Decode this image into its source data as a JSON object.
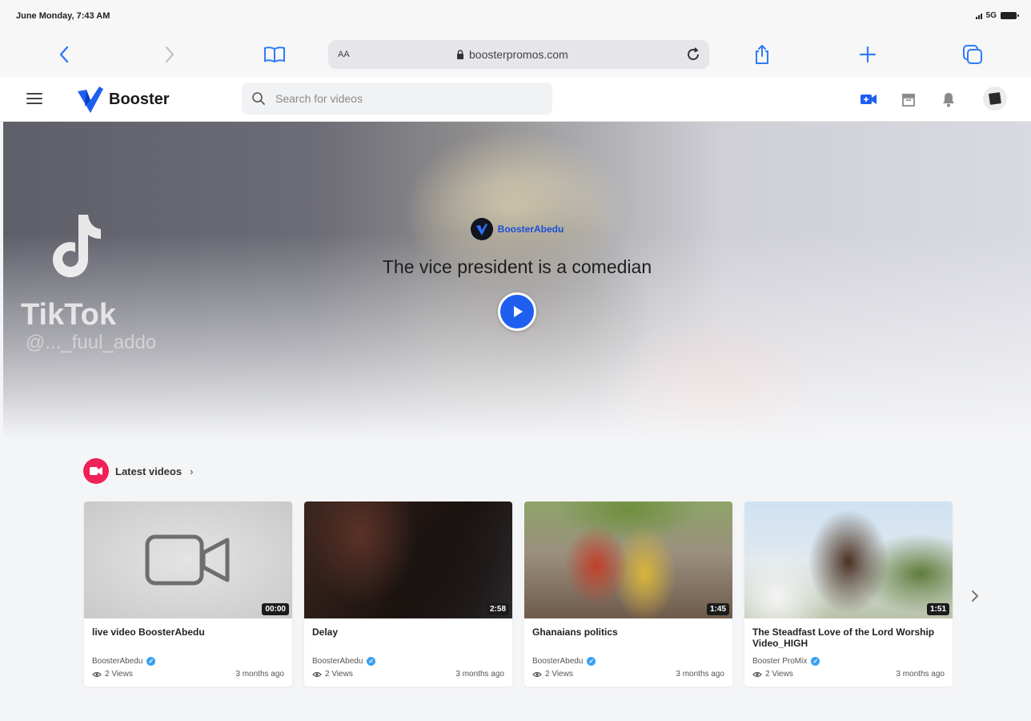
{
  "status_bar": {
    "time": "June Monday, 7:43 AM",
    "network": "5G"
  },
  "browser": {
    "text_size_label": "AA",
    "url": "boosterpromos.com",
    "icons": [
      "back-icon",
      "forward-icon",
      "bookmarks-icon",
      "lock-icon",
      "reload-icon",
      "share-icon",
      "new-tab-icon",
      "tabs-icon"
    ]
  },
  "header": {
    "brand": "Booster",
    "search_placeholder": "Search for videos",
    "icons": [
      "menu-icon",
      "upload-video-icon",
      "archive-icon",
      "notification-bell-icon",
      "user-avatar"
    ]
  },
  "hero": {
    "channel": "BoosterAbedu",
    "title": "The vice president is a comedian",
    "background_watermark": "TikTok",
    "background_handle": "@..._fuul_addo"
  },
  "latest": {
    "section_title": "Latest videos",
    "videos": [
      {
        "title": "live video BoosterAbedu",
        "channel": "BoosterAbedu",
        "views": "2 Views",
        "age": "3 months ago",
        "duration": "00:00"
      },
      {
        "title": "Delay",
        "channel": "BoosterAbedu",
        "views": "2 Views",
        "age": "3 months ago",
        "duration": "2:58"
      },
      {
        "title": "Ghanaians politics",
        "channel": "BoosterAbedu",
        "views": "2 Views",
        "age": "3 months ago",
        "duration": "1:45"
      },
      {
        "title": "The Steadfast Love of the Lord Worship Video_HIGH",
        "channel": "Booster ProMix",
        "views": "2 Views",
        "age": "3 months ago",
        "duration": "1:51"
      }
    ]
  },
  "colors": {
    "accent_blue": "#1f5ff0",
    "ios_blue": "#2f7bf6",
    "section_pink": "#f0205a",
    "verified_blue": "#3aa0f0"
  }
}
